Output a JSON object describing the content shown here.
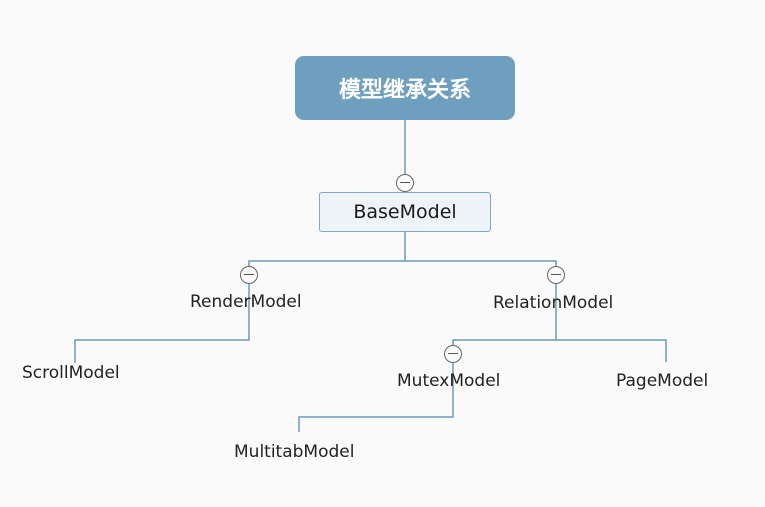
{
  "colors": {
    "background": "#fafafa",
    "root_fill": "#6f9fbe",
    "node_fill": "#eef3f7",
    "node_border": "#7ea9c6",
    "connector": "#6a9ab8",
    "toggle_border": "#666666"
  },
  "icons": {
    "collapse": "collapse-minus-icon"
  },
  "nodes": {
    "root": "模型继承关系",
    "base": "BaseModel",
    "render": "RenderModel",
    "relation": "RelationModel",
    "scroll": "ScrollModel",
    "mutex": "MutexModel",
    "page": "PageModel",
    "multitab": "MultitabModel"
  }
}
